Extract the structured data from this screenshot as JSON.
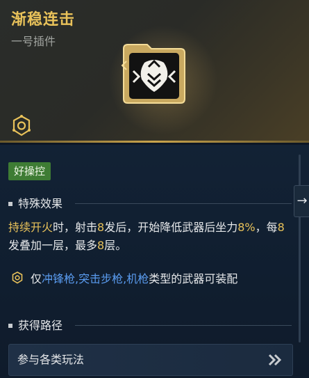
{
  "item": {
    "name": "渐稳连击",
    "category": "一号插件"
  },
  "tag": "好操控",
  "sections": {
    "special_effect": "特殊效果",
    "obtain": "获得路径"
  },
  "effect": {
    "p1": "持续开火",
    "p2": "时，射击",
    "p3": "8",
    "p4": "发后，开始降低武器后坐力",
    "p5": "8%",
    "p6": "，每",
    "p7": "8",
    "p8": "发叠加一层，最多",
    "p9": "8",
    "p10": "层。"
  },
  "restriction": {
    "r1": "仅",
    "r2": "冲锋枪,突击步枪,机枪",
    "r3": "类型的武器可装配"
  },
  "obtain_button": {
    "label": "参与各类玩法"
  },
  "colors": {
    "title": "#e9c25a",
    "highlight_gold": "#e9c25a",
    "highlight_blue": "#5a9cf0",
    "tag_bg": "#3e7c34"
  },
  "icons": {
    "emblem": "plugin-emblem-icon",
    "module": "plugin-slot-icon",
    "restriction": "gear-icon",
    "scroll": "arrow-right-icon",
    "button": "double-chevron-right-icon"
  }
}
